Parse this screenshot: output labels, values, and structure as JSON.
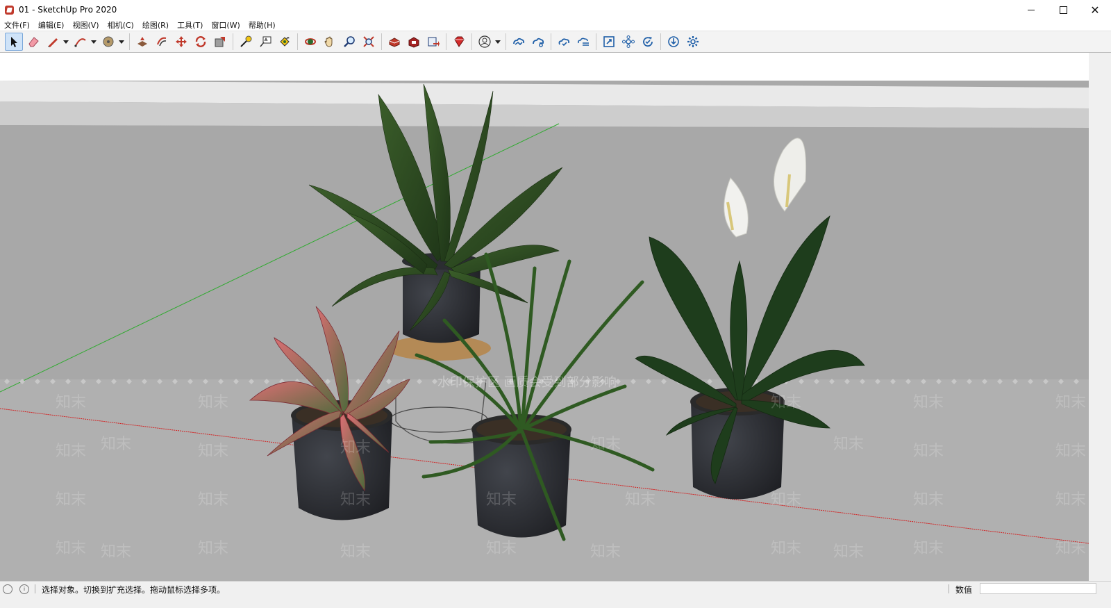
{
  "window": {
    "title": "01 - SketchUp Pro 2020",
    "minimize": "minimize",
    "maximize": "maximize",
    "close": "✕"
  },
  "menu": [
    {
      "label": "文件(F)"
    },
    {
      "label": "编辑(E)"
    },
    {
      "label": "视图(V)"
    },
    {
      "label": "相机(C)"
    },
    {
      "label": "绘图(R)"
    },
    {
      "label": "工具(T)"
    },
    {
      "label": "窗口(W)"
    },
    {
      "label": "帮助(H)"
    }
  ],
  "toolbar": {
    "tools": [
      {
        "icon": "select-arrow-icon",
        "active": true
      },
      {
        "icon": "eraser-icon"
      },
      {
        "icon": "pencil-line-icon",
        "dropdown": true
      },
      {
        "icon": "arc-icon",
        "dropdown": true
      },
      {
        "icon": "circle-shape-icon",
        "dropdown": true
      },
      {
        "icon": "push-pull-icon"
      },
      {
        "icon": "offset-icon"
      },
      {
        "icon": "move-icon"
      },
      {
        "icon": "rotate-icon"
      },
      {
        "icon": "scale-icon"
      },
      {
        "icon": "tape-measure-icon"
      },
      {
        "icon": "text-icon"
      },
      {
        "icon": "paint-bucket-icon"
      },
      {
        "icon": "orbit-icon"
      },
      {
        "icon": "pan-icon"
      },
      {
        "icon": "zoom-icon"
      },
      {
        "icon": "zoom-extents-icon"
      },
      {
        "icon": "3d-warehouse-icon"
      },
      {
        "icon": "extension-warehouse-icon"
      },
      {
        "icon": "layout-send-icon"
      },
      {
        "icon": "ruby-extension-manager-icon"
      },
      {
        "icon": "user-account-icon",
        "dropdown": true
      },
      {
        "icon": "trimble-connect-icon"
      },
      {
        "icon": "trimble-connect-share-icon"
      },
      {
        "icon": "cloud-sync-icon"
      },
      {
        "icon": "cloud-list-icon"
      },
      {
        "icon": "extents-icon"
      },
      {
        "icon": "component-icon"
      },
      {
        "icon": "refresh-check-icon"
      },
      {
        "icon": "download-icon"
      },
      {
        "icon": "settings-icon"
      }
    ]
  },
  "watermark": {
    "banner": "水印保护区 画质会受到部分影响",
    "tile": "知末"
  },
  "status": {
    "message": "选择对象。切换到扩充选择。拖动鼠标选择多项。",
    "value_label": "数值",
    "value_input": ""
  },
  "colors": {
    "sky": "#ffffff",
    "ground": "#a9a9a9",
    "red_axis": "#d32020",
    "green_axis": "#2faa2f",
    "pot": "#2a2c31"
  }
}
